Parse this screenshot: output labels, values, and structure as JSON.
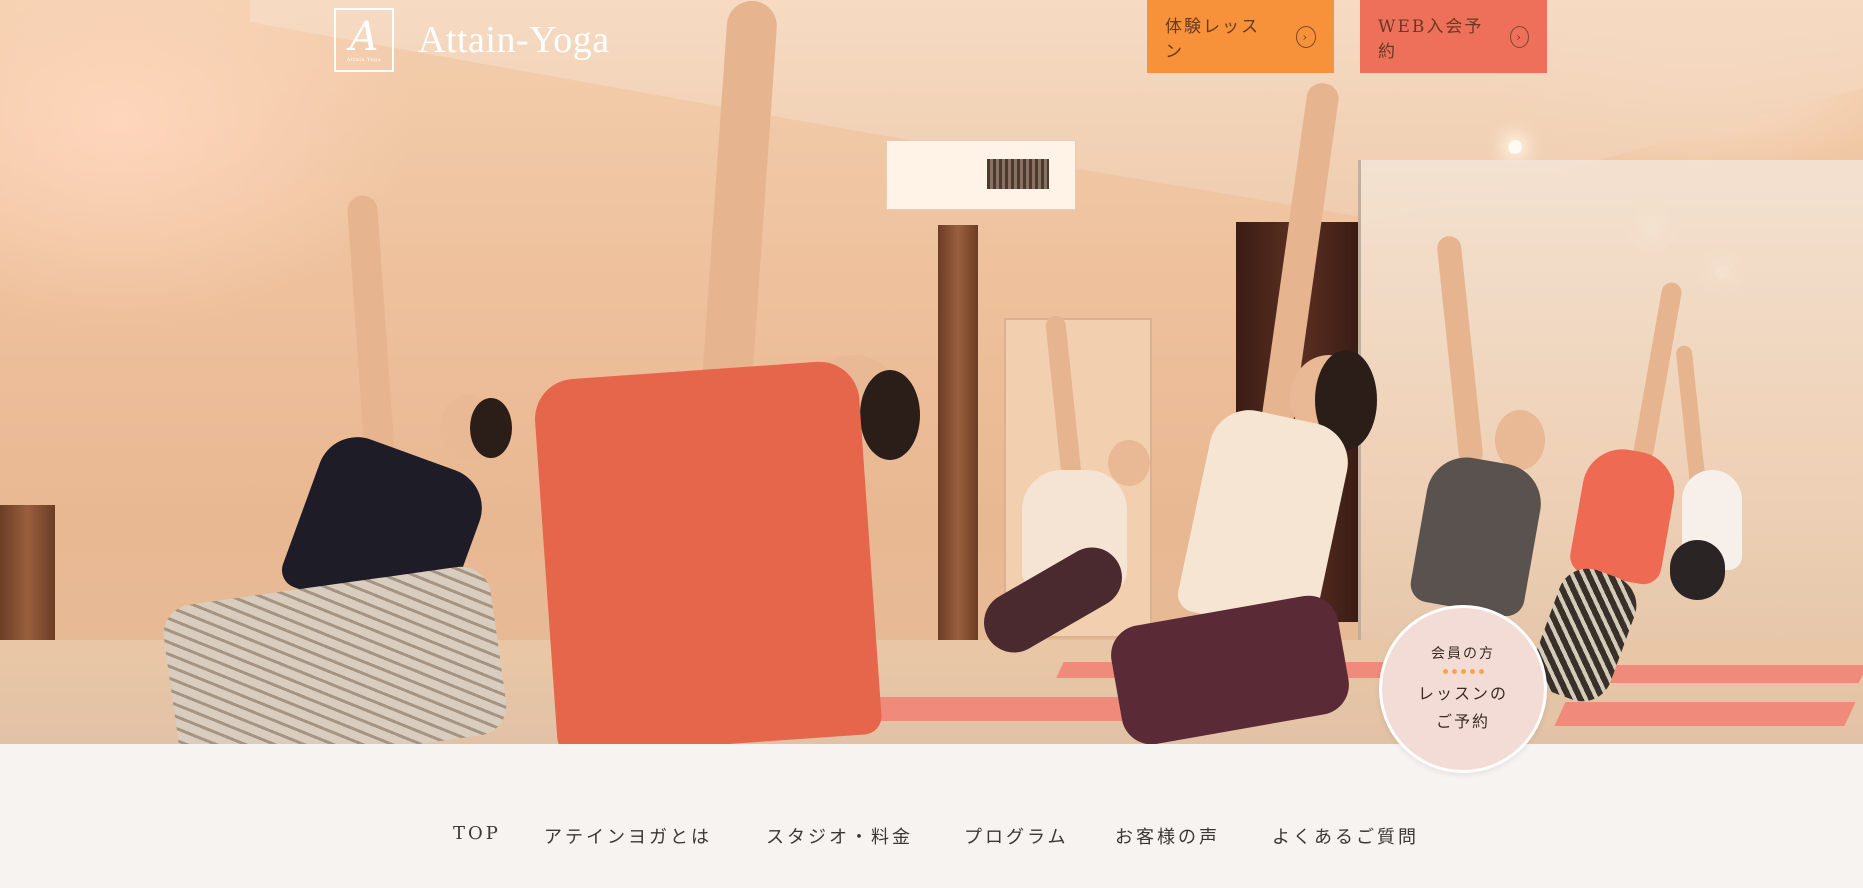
{
  "header": {
    "logo_name": "Attain-Yoga",
    "logo_mark_letter": "A",
    "logo_mark_small": "Attain Yoga",
    "trial_button": "体験レッスン",
    "web_button": "WEB入会予約",
    "arrow_glyph": "›"
  },
  "member_cta": {
    "line1": "会員の方",
    "line2": "レッスンの",
    "line3": "ご予約"
  },
  "nav": {
    "items": [
      "TOP",
      "アテインヨガとは",
      "スタジオ・料金",
      "プログラム",
      "お客様の声",
      "よくあるご質問"
    ]
  },
  "colors": {
    "trial_bg": "#f7913a",
    "web_bg": "#ee6f5a",
    "member_bg": "#f4dcd6",
    "nav_bg": "#f6f3f1"
  }
}
